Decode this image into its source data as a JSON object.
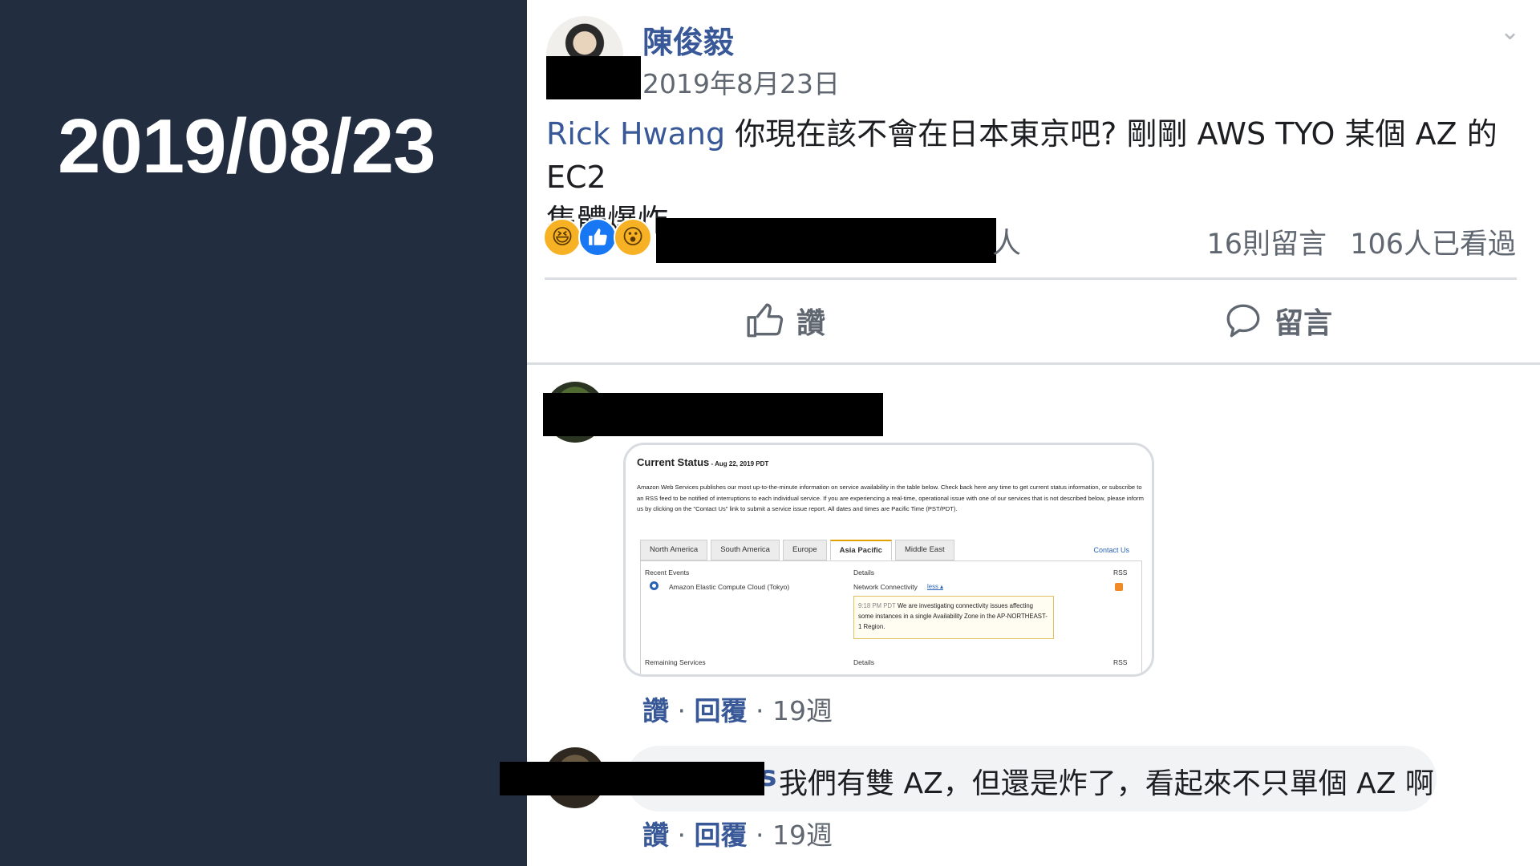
{
  "slide": {
    "date": "2019/08/23"
  },
  "post": {
    "author": "陳俊毅",
    "date": "2019年8月23日",
    "mention": "Rick Hwang",
    "text_line1": " 你現在該不會在日本東京吧? 剛剛 AWS TYO 某個 AZ 的 EC2",
    "text_line2": "集體爆炸",
    "reactions_tail": "人",
    "comments_count": "16則留言",
    "seen_count": "106人已看過",
    "like_label": "讚",
    "comment_label": "留言",
    "chevron": "⌄"
  },
  "screenshot": {
    "title": "Current Status",
    "title_date": " - Aug 22, 2019 PDT",
    "description": "Amazon Web Services publishes our most up-to-the-minute information on service availability in the table below. Check back here any time to get current status information, or subscribe to an RSS feed to be notified of interruptions to each individual service. If you are experiencing a real-time, operational issue with one of our services that is not described below, please inform us by clicking on the \"Contact Us\" link to submit a service issue report. All dates and times are Pacific Time (PST/PDT).",
    "tabs": [
      "North America",
      "South America",
      "Europe",
      "Asia Pacific",
      "Middle East"
    ],
    "contact": "Contact Us",
    "col_recent": "Recent Events",
    "col_details": "Details",
    "col_rss": "RSS",
    "event_service": "Amazon Elastic Compute Cloud (Tokyo)",
    "event_details": "Network Connectivity",
    "event_more": "less ▴",
    "note_time": "9:18 PM PDT",
    "note_text": " We are investigating connectivity issues affecting some instances in a single Availability Zone in the AP-NORTHEAST-1 Region.",
    "remaining": "Remaining Services",
    "remaining_details": "Details",
    "remaining_rss": "RSS"
  },
  "comment1": {
    "like": "讚",
    "sep1": " · ",
    "reply": "回覆",
    "sep2": " · ",
    "time": "19週"
  },
  "comment2": {
    "name_tail": "s",
    "text": "我們有雙 AZ，但還是炸了，看起來不只單個 AZ 啊",
    "like": "讚",
    "sep1": " · ",
    "reply": "回覆",
    "sep2": " · ",
    "time": "19週"
  },
  "icons": {
    "haha": "haha-reaction-icon",
    "like": "like-reaction-icon",
    "wow": "wow-reaction-icon"
  },
  "colors": {
    "left_panel": "#222d3f",
    "link_blue": "#385898",
    "muted": "#606770"
  }
}
